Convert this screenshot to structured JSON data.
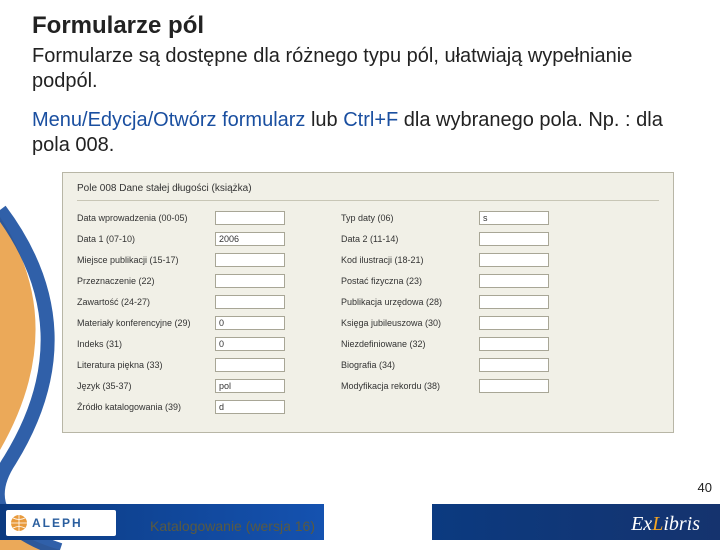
{
  "title": "Formularze pól",
  "description": "Formularze są dostępne dla różnego typu pól, ułatwiają wypełnianie podpól.",
  "instruction": {
    "menu_path": "Menu/Edycja/Otwórz formularz",
    "mid1": " lub ",
    "shortcut": "Ctrl+F",
    "mid2": " dla wybranego pola. Np. : dla pola 008."
  },
  "form": {
    "title": "Pole 008 Dane stałej długości (książka)",
    "rows": [
      {
        "l": "Data wprowadzenia (00-05)",
        "lv": "",
        "r": "Typ daty (06)",
        "rv": "s"
      },
      {
        "l": "Data 1 (07-10)",
        "lv": "2006",
        "r": "Data 2 (11-14)",
        "rv": ""
      },
      {
        "l": "Miejsce publikacji (15-17)",
        "lv": "",
        "r": "Kod ilustracji (18-21)",
        "rv": ""
      },
      {
        "l": "Przeznaczenie (22)",
        "lv": "",
        "r": "Postać fizyczna (23)",
        "rv": ""
      },
      {
        "l": "Zawartość (24-27)",
        "lv": "",
        "r": "Publikacja urzędowa (28)",
        "rv": ""
      },
      {
        "l": "Materiały konferencyjne (29)",
        "lv": "0",
        "r": "Księga jubileuszowa (30)",
        "rv": ""
      },
      {
        "l": "Indeks (31)",
        "lv": "0",
        "r": "Niezdefiniowane (32)",
        "rv": ""
      },
      {
        "l": "Literatura piękna (33)",
        "lv": "",
        "r": "Biografia (34)",
        "rv": ""
      },
      {
        "l": "Język (35-37)",
        "lv": "pol",
        "r": "Modyfikacja rekordu (38)",
        "rv": ""
      },
      {
        "l": "Źródło katalogowania (39)",
        "lv": "d",
        "r": "",
        "rv": ""
      }
    ]
  },
  "page_number": "40",
  "footer_text": "Katalogowanie (wersja 16)",
  "aleph": "ALEPH",
  "exlibris_prefix": "Ex",
  "exlibris_l": "L",
  "exlibris_suffix": "ibris"
}
